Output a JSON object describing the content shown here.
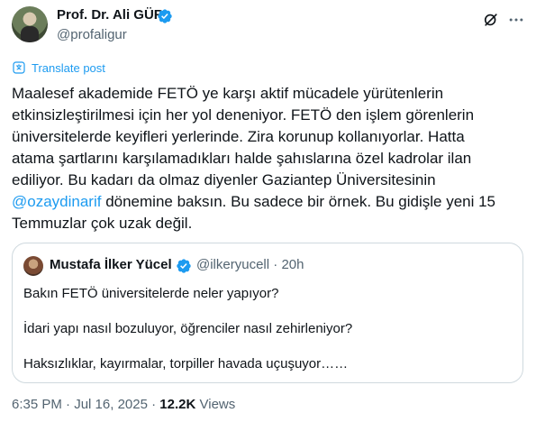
{
  "author": {
    "name": "Prof. Dr. Ali GÜR",
    "handle": "@profaligur"
  },
  "icons": {
    "verified": "verified-badge-icon",
    "grok": "grok-icon",
    "more": "more-icon",
    "translate": "translate-icon"
  },
  "colors": {
    "accent": "#1d9bf0",
    "text": "#0f1419",
    "muted": "#536471",
    "border": "#cfd9de"
  },
  "translate_label": "Translate post",
  "post": {
    "lines": [
      "Maalesef akademide FETÖ ye karşı aktif mücadele yürütenlerin",
      "etkinsizleştirilmesi için her yol deneniyor. FETÖ den işlem görenlerin",
      "üniversitelerde keyifleri yerlerinde. Zira korunup kollanıyorlar. Hatta",
      "atama şartlarını karşılamadıkları halde şahıslarına özel kadrolar ilan",
      "ediliyor. Bu kadarı da olmaz diyenler Gaziantep Üniversitesinin"
    ],
    "mention": "@ozaydinarif",
    "line6_rest": " dönemine baksın. Bu sadece bir örnek. Bu gidişle yeni 15",
    "line7": "Temmuzlar çok uzak değil."
  },
  "quote": {
    "name": "Mustafa İlker Yücel",
    "handle": "@ilkeryucell",
    "separator": "·",
    "time": "20h",
    "lines": [
      "Bakın FETÖ üniversitelerde neler yapıyor?",
      "İdari yapı nasıl bozuluyor, öğrenciler nasıl zehirleniyor?",
      "Haksızlıklar, kayırmalar, torpiller havada uçuşuyor……"
    ]
  },
  "footer": {
    "time": "6:35 PM",
    "separator": "·",
    "date": "Jul 16, 2025",
    "views_count": "12.2K",
    "views_label": "Views"
  }
}
